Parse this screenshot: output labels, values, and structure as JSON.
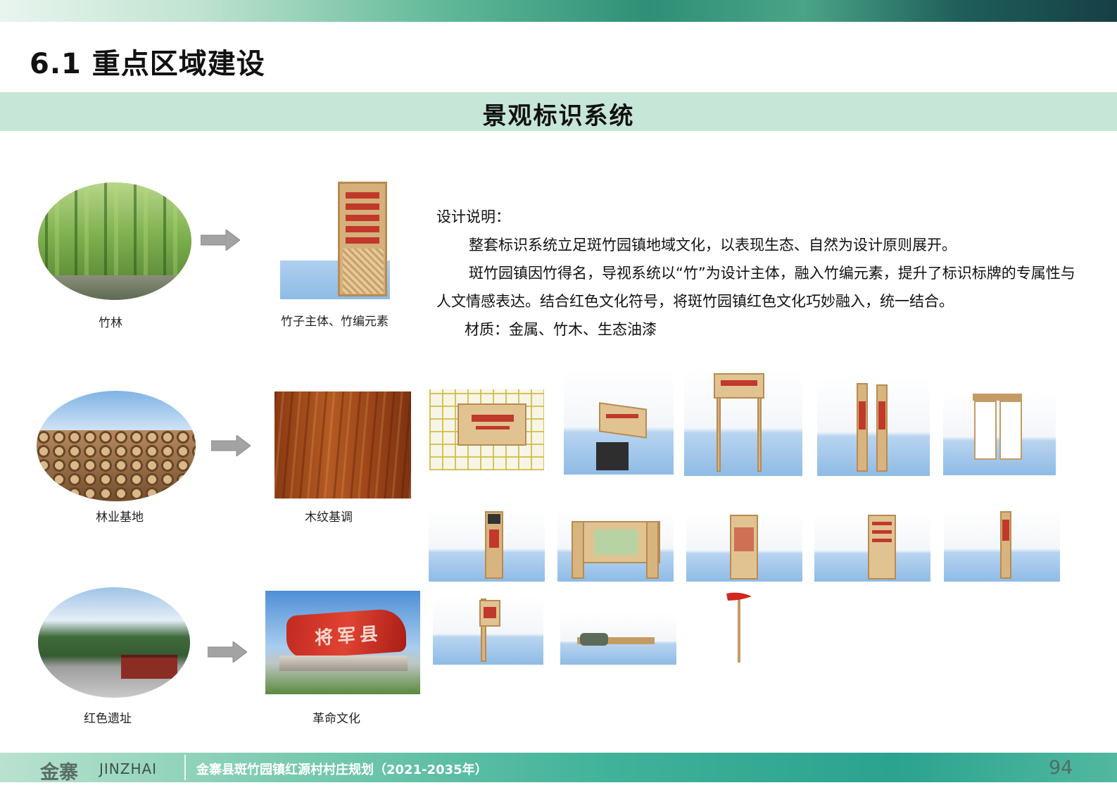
{
  "page": {
    "title": "6.1 重点区域建设",
    "section_title": "景观标识系统"
  },
  "rows": [
    {
      "source_label": "竹林",
      "result_label": "竹子主体、竹编元素"
    },
    {
      "source_label": "林业基地",
      "result_label": "木纹基调"
    },
    {
      "source_label": "红色遗址",
      "result_label": "革命文化"
    }
  ],
  "monument_text": "将军县",
  "description": {
    "heading": "设计说明：",
    "para1": "整套标识系统立足斑竹园镇地域文化，以表现生态、自然为设计原则展开。",
    "para2": "斑竹园镇因竹得名，导视系统以“竹”为设计主体，融入竹编元素，提升了标识标牌的专属性与人文情感表达。结合红色文化符号，将斑竹园镇红色文化巧妙融入，统一结合。",
    "material": "材质：金属、竹木、生态油漆"
  },
  "footer": {
    "logo": "金寨",
    "logo_en": "JINZHAI",
    "project": "金寨县斑竹园镇红源村村庄规划（2021-2035年）",
    "page_number": "94"
  }
}
